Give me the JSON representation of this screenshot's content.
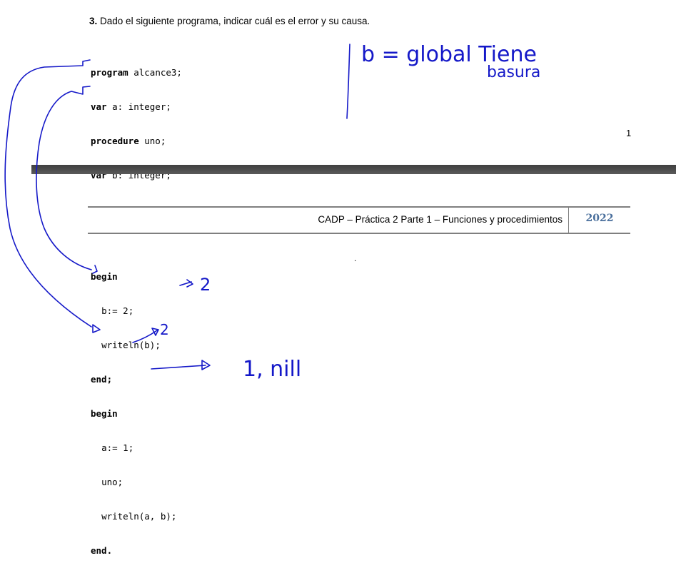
{
  "question": {
    "number": "3.",
    "text": "Dado el siguiente programa, indicar cuál es el error y su causa."
  },
  "code_part1": [
    {
      "kw": "program",
      "rest": " alcance3;"
    },
    {
      "kw": "var",
      "rest": " a: integer;"
    },
    {
      "kw": "procedure",
      "rest": " uno;"
    },
    {
      "kw": "var",
      "rest": " b: integer;"
    }
  ],
  "page_number": "1",
  "header": {
    "title": "CADP – Práctica 2 Parte 1 – Funciones y procedimientos",
    "year": "2022"
  },
  "code_part2": [
    {
      "kw": "begin",
      "rest": "",
      "indent": ""
    },
    {
      "kw": "",
      "rest": "b:= 2;",
      "indent": "  "
    },
    {
      "kw": "",
      "rest": "writeln(b);",
      "indent": "  "
    },
    {
      "kw": "end;",
      "rest": "",
      "indent": ""
    },
    {
      "kw": "begin",
      "rest": "",
      "indent": ""
    },
    {
      "kw": "",
      "rest": "a:= 1;",
      "indent": "  "
    },
    {
      "kw": "",
      "rest": "uno;",
      "indent": "  "
    },
    {
      "kw": "",
      "rest": "writeln(a, b);",
      "indent": "  "
    },
    {
      "kw": "end.",
      "rest": "",
      "indent": ""
    }
  ],
  "dot": ".",
  "handwriting": {
    "note_line1": "b = global Tiene",
    "note_line2": "basura",
    "out_b": "2",
    "out_a_call": "2",
    "out_final": "1, nill"
  },
  "colors": {
    "ink": "#1418c8",
    "header_year": "#4a6f9c",
    "rule": "#7f7f7f"
  }
}
